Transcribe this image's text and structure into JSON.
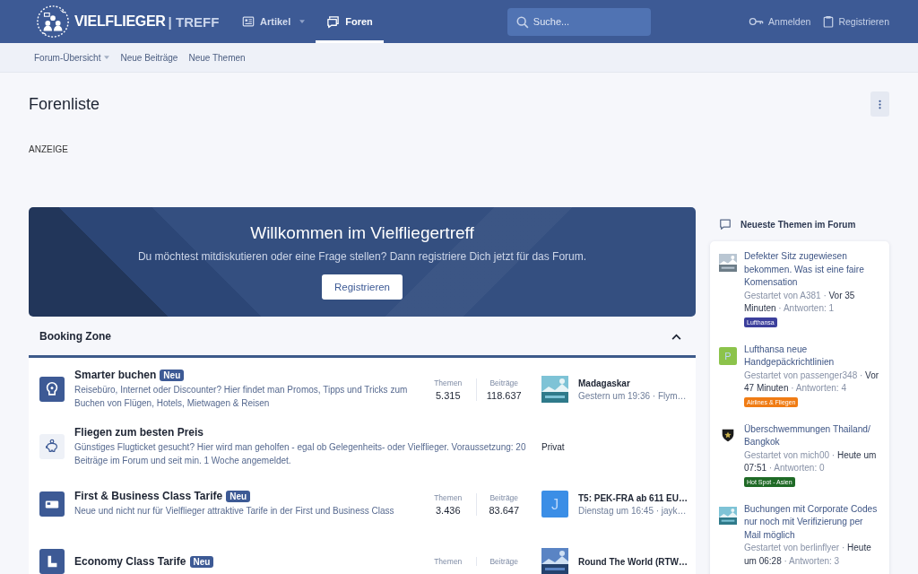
{
  "header": {
    "logo_name": "VIELFLIEGER",
    "logo_suffix": "| TREFF",
    "nav": [
      {
        "label": "Artikel",
        "dropdown": true,
        "selected": false
      },
      {
        "label": "Foren",
        "dropdown": false,
        "selected": true
      }
    ],
    "search": {
      "placeholder": "Suche..."
    },
    "account": [
      {
        "label": "Anmelden"
      },
      {
        "label": "Registrieren"
      }
    ]
  },
  "subnav": [
    {
      "label": "Forum-Übersicht",
      "dropdown": true
    },
    {
      "label": "Neue Beiträge",
      "dropdown": false
    },
    {
      "label": "Neue Themen",
      "dropdown": false
    }
  ],
  "page_title": "Forenliste",
  "ad_label": "ANZEIGE",
  "banner": {
    "title": "Willkommen im Vielfliegertreff",
    "text": "Du möchtest mitdiskutieren oder eine Frage stellen? Dann registriere Dich jetzt für das Forum.",
    "button": "Registrieren"
  },
  "section": {
    "title": "Booking Zone",
    "expanded": true,
    "forums": [
      {
        "title": "Smarter buchen",
        "badge": "Neu",
        "description": "Reisebüro, Internet oder Discounter? Hier findet man Promos, Tipps und Tricks zum Buchen von Flügen, Hotels, Mietwagen & Reisen",
        "stats": [
          {
            "label": "Themen",
            "value": "5.315"
          },
          {
            "label": "Beiträge",
            "value": "118.637"
          }
        ],
        "last_post": {
          "title": "Madagaskar",
          "meta": "Gestern um 19:36 · Flym…"
        }
      },
      {
        "title": "Fliegen zum besten Preis",
        "description": "Günstiges Flugticket gesucht? Hier wird man geholfen - egal ob Gelegenheits- oder Vielflieger. Voraussetzung: 20 Beiträge im Forum und seit min. 1 Woche angemeldet.",
        "access": "Privat"
      },
      {
        "title": "First & Business Class Tarife",
        "badge": "Neu",
        "description": "Neue und nicht nur für Vielflieger attraktive Tarife in der First und Business Class",
        "stats": [
          {
            "label": "Themen",
            "value": "3.436"
          },
          {
            "label": "Beiträge",
            "value": "83.647"
          }
        ],
        "last_post": {
          "avatar": {
            "kind": "letter",
            "letter": "J",
            "color": "#3b8ee6"
          },
          "title": "T5: PEK-FRA ab 611 EU…",
          "meta": "Dienstag um 16:45 · jayk…"
        }
      },
      {
        "title": "Economy Class Tarife",
        "badge": "Neu",
        "stats": [
          {
            "label": "Themen"
          },
          {
            "label": "Beiträge"
          }
        ],
        "last_post": {
          "title": "Round The World (RTW…"
        }
      }
    ]
  },
  "sidebar": {
    "title": "Neueste Themen im Forum",
    "topics": [
      {
        "title": "Defekter Sitz zugewiesen bekommen. Was ist eine faire Komensation",
        "starter": "Gestartet von A381 ·",
        "time": "Vor 35 Minuten",
        "replies": "· Antworten: 1",
        "tag": {
          "label": "Lufthansa",
          "color": "#3c3f9c"
        }
      },
      {
        "avatar": {
          "kind": "letter",
          "letter": "P",
          "color": "#8cc34b"
        },
        "title": "Lufthansa neue Handgepäckrichtlinien",
        "starter": "Gestartet von passenger348 ·",
        "time": "Vor 47 Minuten",
        "replies": "· Antworten: 4",
        "tag": {
          "label": "Airlines & Fliegen",
          "color": "#f07c14"
        }
      },
      {
        "avatar": {
          "kind": "shield"
        },
        "title": "Überschwemmungen Thailand/ Bangkok",
        "starter": "Gestartet von mich00 ·",
        "time": "Heute um 07:51",
        "replies": "· Antworten: 0",
        "tag": {
          "label": "Hot Spot - Asien",
          "color": "#1f6a26"
        }
      },
      {
        "title": "Buchungen mit Corporate Codes nur noch mit Verifizierung per Mail möglich",
        "starter": "Gestartet von berlinflyer ·",
        "time": "Heute um 06:28",
        "replies": "· Antworten: 3"
      }
    ]
  }
}
